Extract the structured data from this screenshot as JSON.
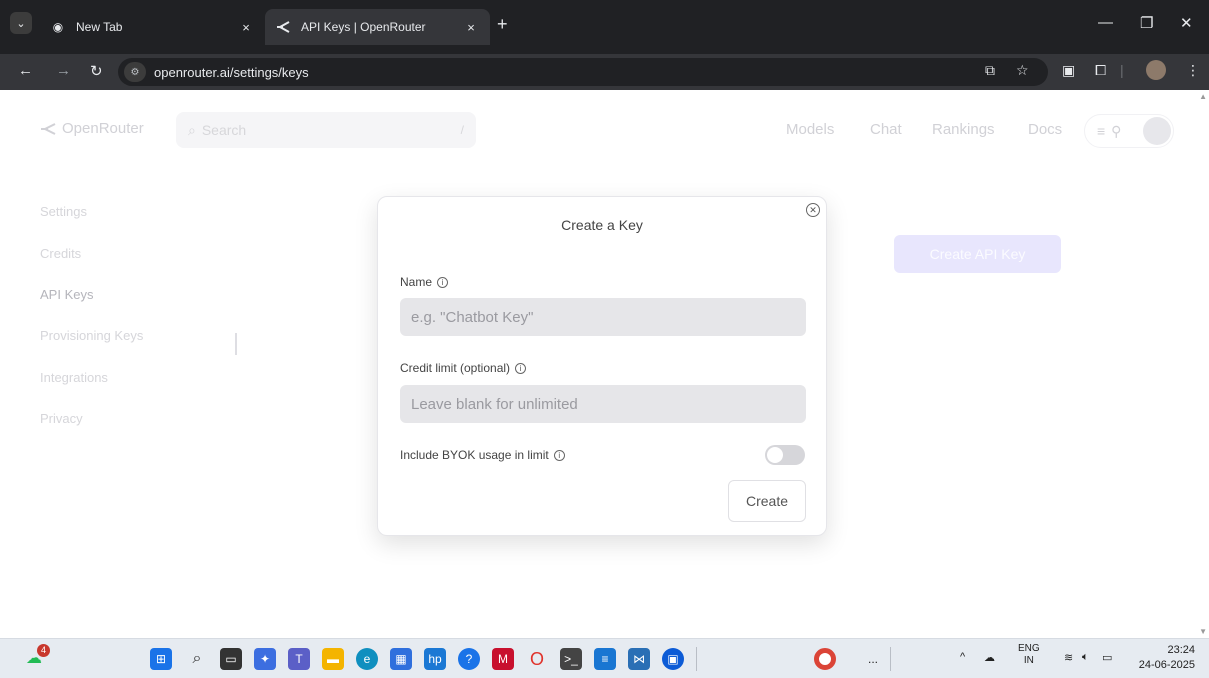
{
  "browser": {
    "tabs": [
      {
        "title": "New Tab",
        "close": "×"
      },
      {
        "title": "API Keys | OpenRouter",
        "close": "×"
      }
    ],
    "new_tab": "+",
    "url": "openrouter.ai/settings/keys"
  },
  "header": {
    "logo": "OpenRouter",
    "search_placeholder": "Search",
    "search_shortcut": "/",
    "nav": [
      "Models",
      "Chat",
      "Rankings",
      "Docs"
    ]
  },
  "sidebar": {
    "items": [
      "Settings",
      "Credits",
      "API Keys",
      "Provisioning Keys",
      "Integrations",
      "Privacy"
    ]
  },
  "main": {
    "create_api_key": "Create API Key"
  },
  "modal": {
    "title": "Create a Key",
    "name_label": "Name",
    "name_placeholder": "e.g. \"Chatbot Key\"",
    "credit_label": "Credit limit (optional)",
    "credit_placeholder": "Leave blank for unlimited",
    "byok_label": "Include BYOK usage in limit",
    "byok_enabled": false,
    "create_button": "Create"
  },
  "taskbar": {
    "notification_badge": "4",
    "tray_lang_top": "ENG",
    "tray_lang_bottom": "IN",
    "time": "23:24",
    "date": "24-06-2025",
    "overflow": "..."
  }
}
